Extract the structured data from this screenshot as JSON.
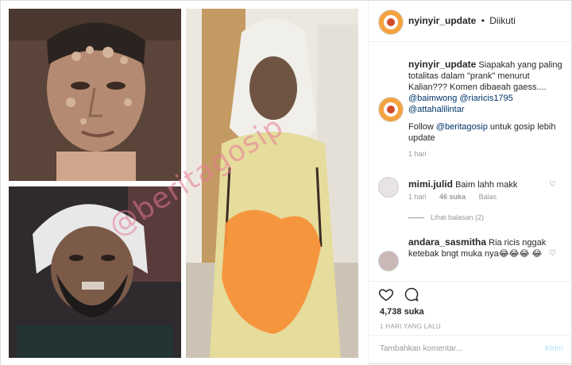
{
  "header": {
    "username": "nyinyir_update",
    "separator": "•",
    "follow_status": "Diikuti"
  },
  "caption": {
    "username": "nyinyir_update",
    "text": "Siapakah yang paling totalitas dalam \"prank\" menurut Kalian??? Komen dibaeah gaess....",
    "mentions": [
      "@baimwong",
      "@riaricis1795",
      "@attahalilintar"
    ],
    "follow_prefix": "Follow",
    "follow_mention": "@beritagosip",
    "follow_suffix": "untuk gosip lebih update",
    "time": "1 hari"
  },
  "comments": [
    {
      "username": "mimi.julid",
      "text": "Baim lahh makk",
      "time": "1 hari",
      "likes": "46 suka",
      "reply": "Balas",
      "view_replies": "Lihat balasan (2)"
    },
    {
      "username": "andara_sasmitha",
      "text": "Ria ricis nggak ketebak bngt muka nya😂😂😂 😂"
    }
  ],
  "actions": {
    "likes": "4,738 suka",
    "date": "1 HARI YANG LALU"
  },
  "add_comment": {
    "placeholder": "Tambahkan komentar...",
    "post_label": "Kirim"
  },
  "watermark": "@beritagosip",
  "icons": {
    "like": "heart-icon",
    "comment": "comment-icon",
    "comment_like": "small-heart-icon"
  },
  "colors": {
    "avatar_ring": "#f4a340",
    "mention": "#003569",
    "muted": "#999999"
  }
}
